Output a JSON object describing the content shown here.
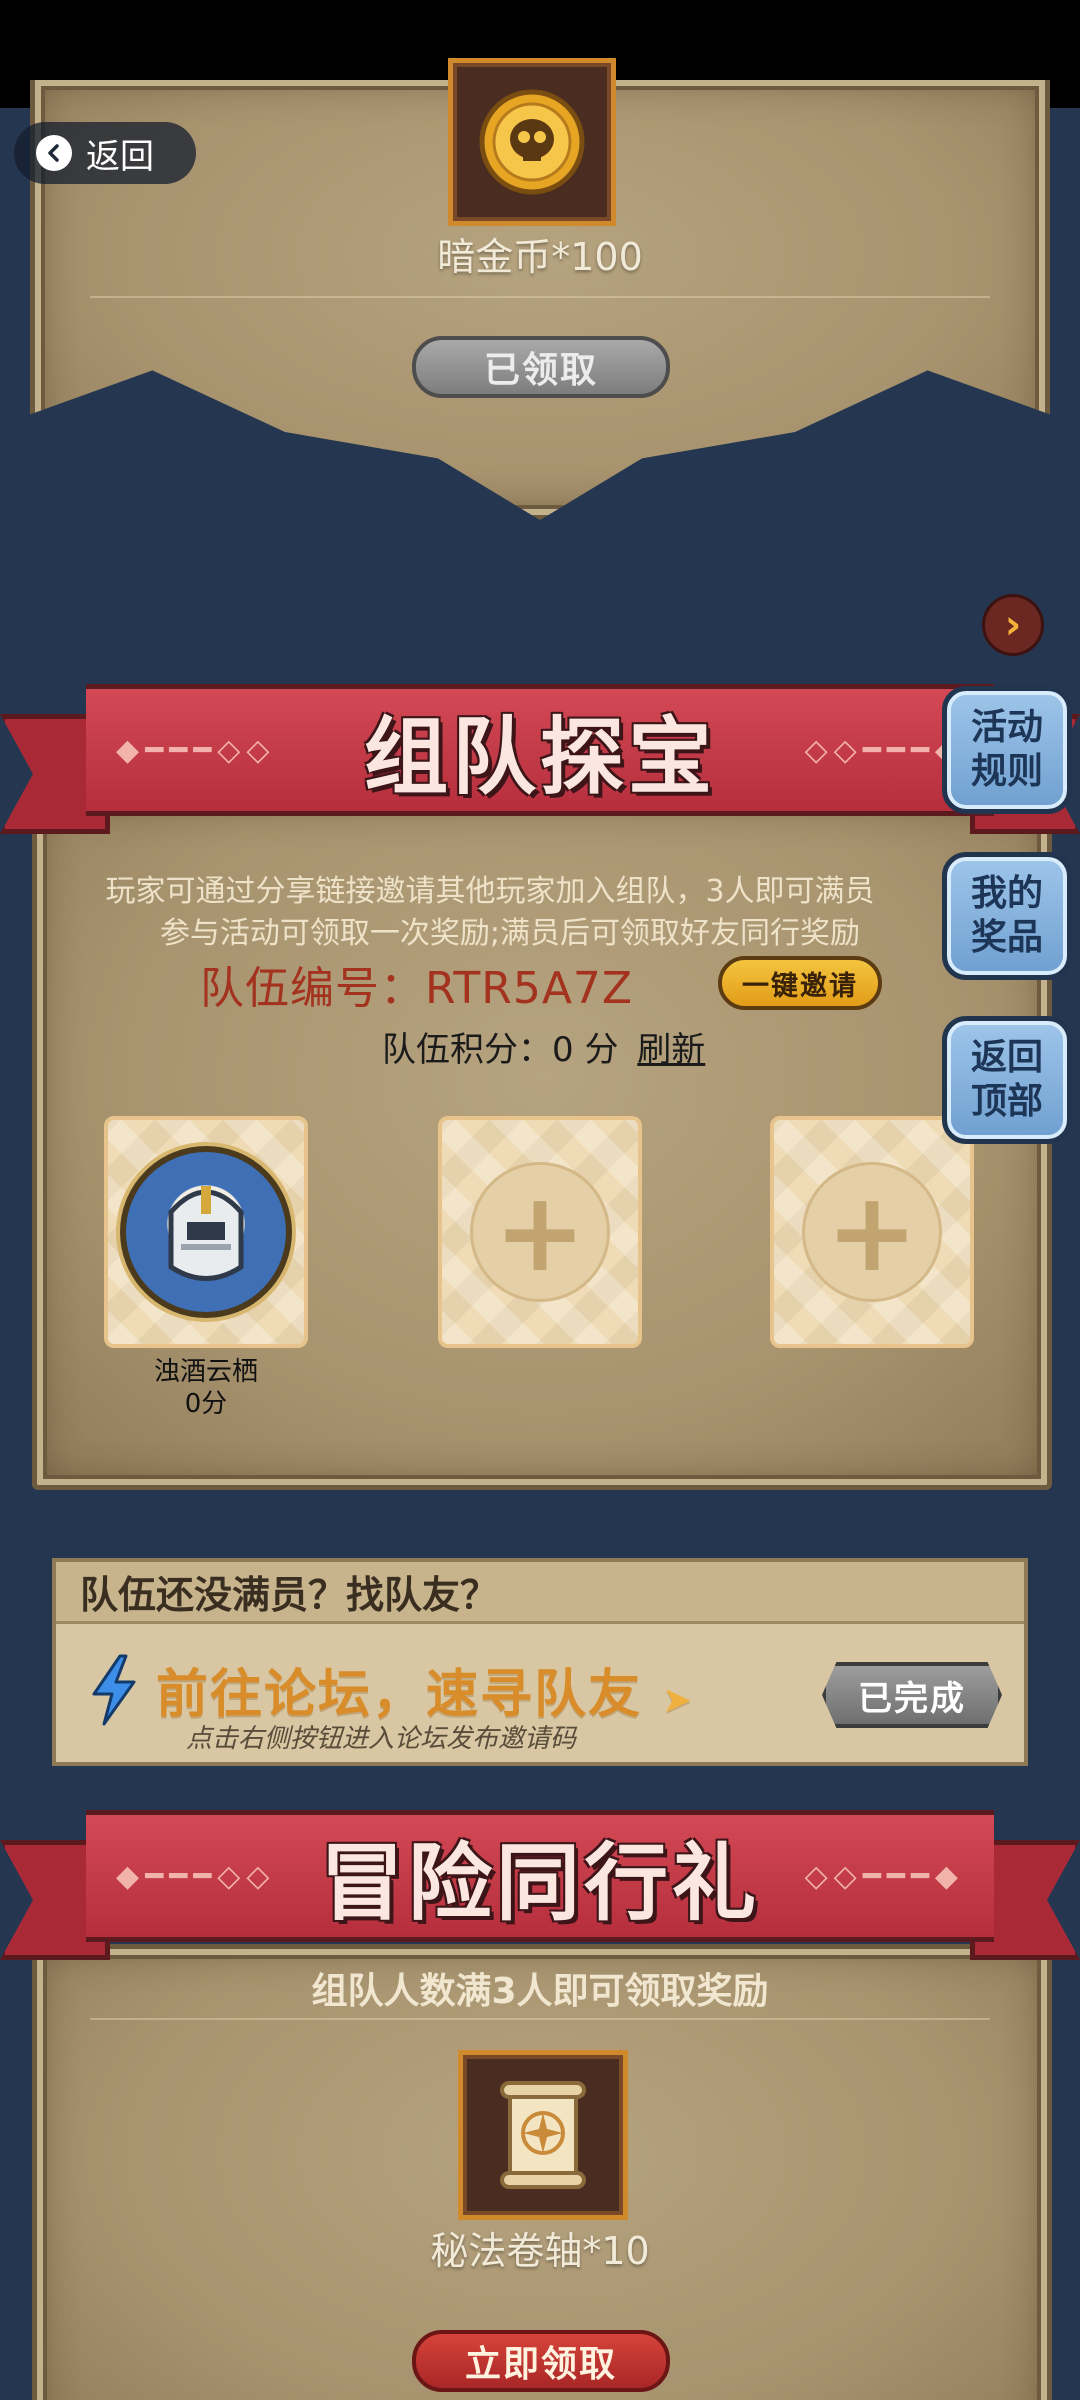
{
  "nav": {
    "back_label": "返回"
  },
  "top_reward": {
    "item_label": "暗金币*100",
    "button_label": "已领取"
  },
  "team_section": {
    "title": "组队探宝",
    "description_line1": "玩家可通过分享链接邀请其他玩家加入组队，3人即可满员",
    "description_line2": "参与活动可领取一次奖励;满员后可领取好友同行奖励",
    "team_code_label": "队伍编号：RTR5A7Z",
    "invite_button": "一键邀请",
    "score_label": "队伍积分：0 分",
    "refresh_label": "刷新",
    "members": [
      {
        "name": "浊酒云栖",
        "score": "0分"
      }
    ]
  },
  "side_buttons": [
    {
      "label": "活动规则"
    },
    {
      "label": "我的奖品"
    },
    {
      "label": "返回顶部"
    }
  ],
  "forum": {
    "header": "队伍还没满员？找队友？",
    "main": "前往论坛，速寻队友",
    "sub": "点击右侧按钮进入论坛发布邀请码",
    "button_label": "已完成"
  },
  "adventure_section": {
    "title": "冒险同行礼",
    "subtitle": "组队人数满3人即可领取奖励",
    "item_label": "秘法卷轴*10",
    "button_label": "立即领取"
  },
  "colors": {
    "background": "#253750",
    "banner_red": "#c43a47",
    "parchment": "#a7936e",
    "side_button_blue": "#8db6e2",
    "accent_yellow": "#f0b530"
  }
}
